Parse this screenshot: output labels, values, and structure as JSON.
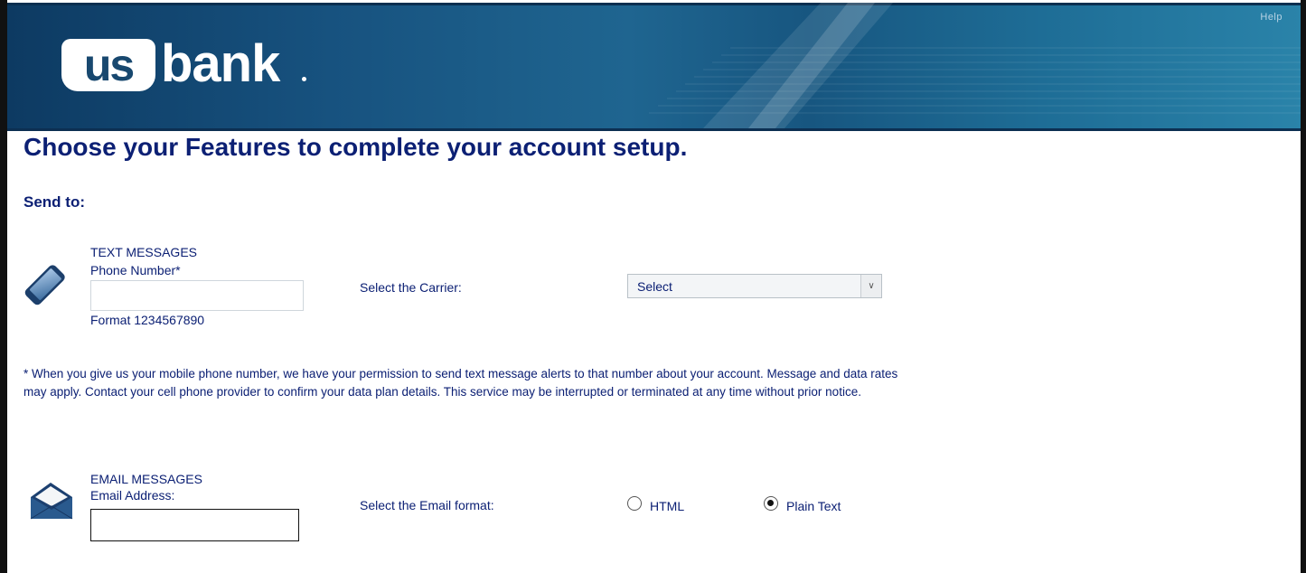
{
  "header": {
    "help_label": "Help",
    "logo_us": "us",
    "logo_bank": "bank"
  },
  "page": {
    "title": "Choose your Features to complete your account setup.",
    "send_to_label": "Send to:"
  },
  "text_messages": {
    "heading": "TEXT MESSAGES",
    "phone_label": "Phone Number*",
    "phone_value": "",
    "phone_placeholder": "",
    "format_hint": "Format 1234567890",
    "carrier_label": "Select the Carrier:",
    "carrier_selected": "Select",
    "icon": "mobile-phone-icon"
  },
  "disclaimer": "* When you give us your mobile phone number, we have your permission to send text message alerts to that number about your account. Message and data rates may apply. Contact your cell phone provider to confirm your data plan details. This service may be interrupted or terminated at any time without prior notice.",
  "email_messages": {
    "heading": "EMAIL MESSAGES",
    "email_label": "Email Address:",
    "email_value": "",
    "email_placeholder": "",
    "format_label": "Select the Email format:",
    "options": [
      {
        "label": "HTML",
        "selected": false
      },
      {
        "label": "Plain Text",
        "selected": true
      }
    ],
    "icon": "envelope-icon"
  },
  "colors": {
    "text_primary": "#0c2074",
    "header_dark": "#0d3a62",
    "header_light": "#2a83a9"
  }
}
